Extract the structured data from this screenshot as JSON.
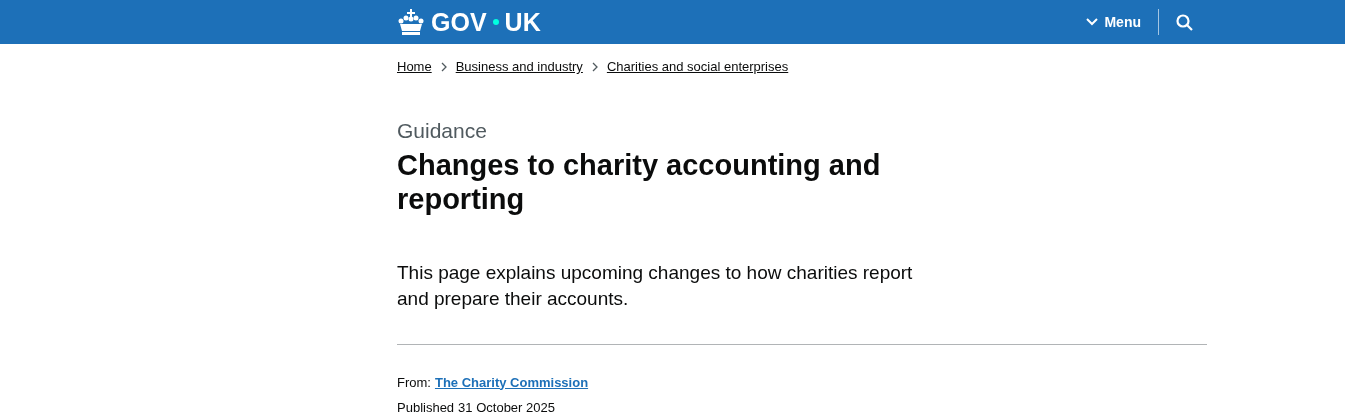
{
  "header": {
    "logo": [
      "GOV",
      "UK"
    ],
    "menu": "Menu"
  },
  "breadcrumbs": [
    "Home",
    "Business and industry",
    "Charities and social enterprises"
  ],
  "caption": "Guidance",
  "title": "Changes to charity accounting and reporting",
  "lead": "This page explains upcoming changes to how charities report and prepare their accounts.",
  "metadata": {
    "from_label": "From:",
    "from": "The Charity Commission",
    "published_label": "Published",
    "published": "31 October 2025"
  }
}
